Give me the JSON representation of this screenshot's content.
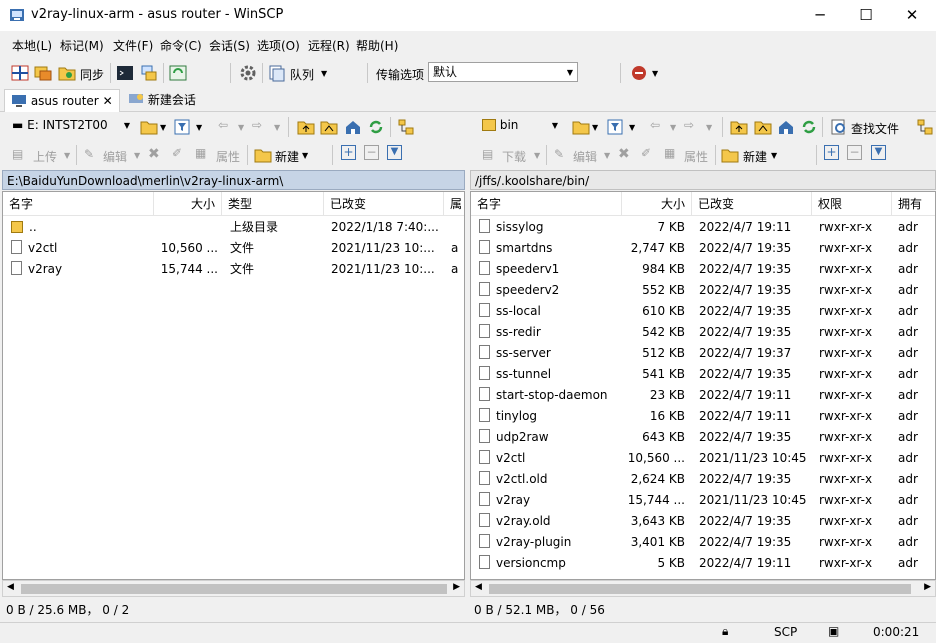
{
  "window": {
    "title": "v2ray-linux-arm - asus router - WinSCP",
    "minimize": "─",
    "maximize": "☐",
    "close": "✕"
  },
  "menu": [
    "本地(L)",
    "标记(M)",
    "文件(F)",
    "命令(C)",
    "会话(S)",
    "选项(O)",
    "远程(R)",
    "帮助(H)"
  ],
  "toolbar": {
    "sync": "同步",
    "queue": "队列",
    "transfer_label": "传输选项",
    "transfer_value": "默认"
  },
  "tabs": [
    {
      "label": "asus router"
    },
    {
      "label": "新建会话"
    }
  ],
  "left": {
    "drive": "E: INTST2T00",
    "upload": "上传",
    "edit": "编辑",
    "props": "属性",
    "new": "新建",
    "path": "E:\\BaiduYunDownload\\merlin\\v2ray-linux-arm\\",
    "columns": [
      "名字",
      "大小",
      "类型",
      "已改变",
      "属"
    ],
    "rows": [
      {
        "name": "..",
        "size": "",
        "type": "上级目录",
        "changed": "2022/1/18  7:40:...",
        "attr": ""
      },
      {
        "name": "v2ctl",
        "size": "10,560 ...",
        "type": "文件",
        "changed": "2021/11/23  10:...",
        "attr": "a"
      },
      {
        "name": "v2ray",
        "size": "15,744 ...",
        "type": "文件",
        "changed": "2021/11/23  10:...",
        "attr": "a"
      }
    ],
    "status": "0 B / 25.6 MB，  0 / 2"
  },
  "right": {
    "dir": "bin",
    "download": "下载",
    "edit": "编辑",
    "props": "属性",
    "new": "新建",
    "find": "查找文件",
    "path": "/jffs/.koolshare/bin/",
    "columns": [
      "名字",
      "大小",
      "已改变",
      "权限",
      "拥有"
    ],
    "rows": [
      {
        "name": "sissylog",
        "size": "7 KB",
        "changed": "2022/4/7 19:11",
        "perm": "rwxr-xr-x",
        "owner": "adr"
      },
      {
        "name": "smartdns",
        "size": "2,747 KB",
        "changed": "2022/4/7 19:35",
        "perm": "rwxr-xr-x",
        "owner": "adr"
      },
      {
        "name": "speederv1",
        "size": "984 KB",
        "changed": "2022/4/7 19:35",
        "perm": "rwxr-xr-x",
        "owner": "adr"
      },
      {
        "name": "speederv2",
        "size": "552 KB",
        "changed": "2022/4/7 19:35",
        "perm": "rwxr-xr-x",
        "owner": "adr"
      },
      {
        "name": "ss-local",
        "size": "610 KB",
        "changed": "2022/4/7 19:35",
        "perm": "rwxr-xr-x",
        "owner": "adr"
      },
      {
        "name": "ss-redir",
        "size": "542 KB",
        "changed": "2022/4/7 19:35",
        "perm": "rwxr-xr-x",
        "owner": "adr"
      },
      {
        "name": "ss-server",
        "size": "512 KB",
        "changed": "2022/4/7 19:37",
        "perm": "rwxr-xr-x",
        "owner": "adr"
      },
      {
        "name": "ss-tunnel",
        "size": "541 KB",
        "changed": "2022/4/7 19:35",
        "perm": "rwxr-xr-x",
        "owner": "adr"
      },
      {
        "name": "start-stop-daemon",
        "size": "23 KB",
        "changed": "2022/4/7 19:11",
        "perm": "rwxr-xr-x",
        "owner": "adr"
      },
      {
        "name": "tinylog",
        "size": "16 KB",
        "changed": "2022/4/7 19:11",
        "perm": "rwxr-xr-x",
        "owner": "adr"
      },
      {
        "name": "udp2raw",
        "size": "643 KB",
        "changed": "2022/4/7 19:35",
        "perm": "rwxr-xr-x",
        "owner": "adr"
      },
      {
        "name": "v2ctl",
        "size": "10,560 ...",
        "changed": "2021/11/23 10:45",
        "perm": "rwxr-xr-x",
        "owner": "adr"
      },
      {
        "name": "v2ctl.old",
        "size": "2,624 KB",
        "changed": "2022/4/7 19:35",
        "perm": "rwxr-xr-x",
        "owner": "adr"
      },
      {
        "name": "v2ray",
        "size": "15,744 ...",
        "changed": "2021/11/23 10:45",
        "perm": "rwxr-xr-x",
        "owner": "adr"
      },
      {
        "name": "v2ray.old",
        "size": "3,643 KB",
        "changed": "2022/4/7 19:35",
        "perm": "rwxr-xr-x",
        "owner": "adr"
      },
      {
        "name": "v2ray-plugin",
        "size": "3,401 KB",
        "changed": "2022/4/7 19:35",
        "perm": "rwxr-xr-x",
        "owner": "adr"
      },
      {
        "name": "versioncmp",
        "size": "5 KB",
        "changed": "2022/4/7 19:11",
        "perm": "rwxr-xr-x",
        "owner": "adr"
      }
    ],
    "status": "0 B / 52.1 MB，  0 / 56"
  },
  "bottom": {
    "protocol": "SCP",
    "time": "0:00:21"
  },
  "colors": {
    "path_bg": "#c6d4e6",
    "folder": "#f4c74a"
  }
}
